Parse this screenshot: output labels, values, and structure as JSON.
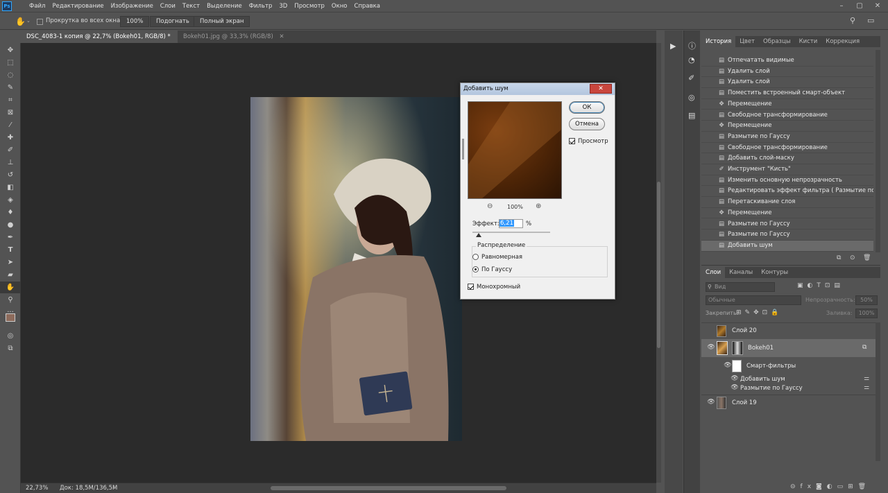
{
  "menubar": {
    "app_icon": "Ps",
    "items": [
      "Файл",
      "Редактирование",
      "Изображение",
      "Слои",
      "Текст",
      "Выделение",
      "Фильтр",
      "3D",
      "Просмотр",
      "Окно",
      "Справка"
    ]
  },
  "options": {
    "scroll_all_label": "Прокрутка во всех окнах",
    "zoom_value": "100%",
    "fit_label": "Подогнать",
    "fullscreen_label": "Полный экран"
  },
  "tabs": [
    {
      "label": "DSC_4083-1 копия @ 22,7% (Bokeh01, RGB/8) *",
      "active": true
    },
    {
      "label": "Bokeh01.jpg @ 33,3% (RGB/8)",
      "active": false
    }
  ],
  "status": {
    "zoom": "22,73%",
    "doc": "Док: 18,5M/136,5M"
  },
  "dialog": {
    "title": "Добавить шум",
    "ok_label": "ОК",
    "cancel_label": "Отмена",
    "preview_label": "Просмотр",
    "zoom_level": "100%",
    "effect_label": "Эффект:",
    "effect_value": "6,21",
    "effect_unit": "%",
    "distribution_label": "Распределение",
    "uniform_label": "Равномерная",
    "gaussian_label": "По Гауссу",
    "mono_label": "Монохромный"
  },
  "history": {
    "tabs": [
      "История",
      "Цвет",
      "Образцы",
      "Кисти",
      "Коррекция"
    ],
    "items": [
      "Отпечатать видимые",
      "Удалить слой",
      "Удалить слой",
      "Поместить встроенный смарт-объект",
      "Перемещение",
      "Свободное трансформирование",
      "Перемещение",
      "Размытие по Гауссу",
      "Свободное трансформирование",
      "Добавить слой-маску",
      "Инструмент \"Кисть\"",
      "Изменить основную непрозрачность",
      "Редактировать эффект фильтра ( Размытие по Гаусс...",
      "Перетаскивание слоя",
      "Перемещение",
      "Размытие по Гауссу",
      "Размытие по Гауссу",
      "Добавить шум"
    ]
  },
  "layers": {
    "tabs": [
      "Слои",
      "Каналы",
      "Контуры"
    ],
    "search_placeholder": "Вид",
    "blend_mode": "Обычные",
    "opacity_label": "Непрозрачность:",
    "opacity_value": "50%",
    "lock_label": "Закрепить:",
    "fill_label": "Заливка:",
    "fill_value": "100%",
    "rows": {
      "layer20": "Слой 20",
      "bokeh": "Bokeh01",
      "smart_filters": "Смарт-фильтры",
      "add_noise": "Добавить шум",
      "gauss": "Размытие по Гауссу",
      "layer19": "Слой 19"
    }
  }
}
